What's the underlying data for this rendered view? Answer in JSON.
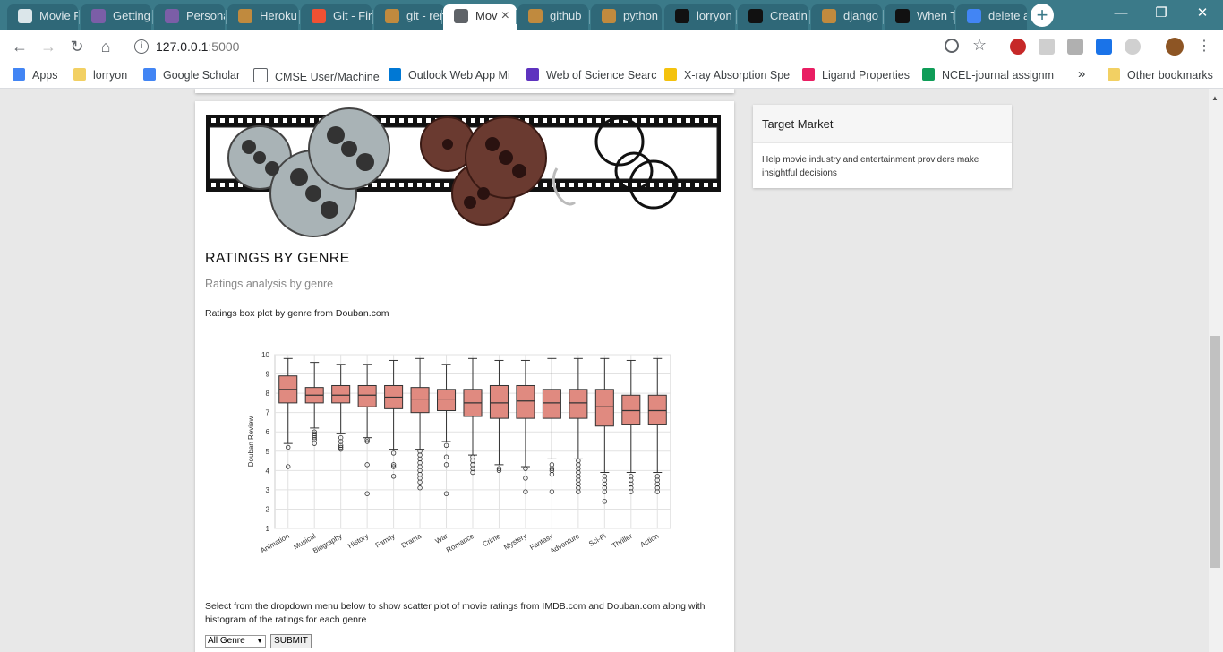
{
  "browser": {
    "tabs": [
      {
        "label": "Movie F",
        "icon_color": "#dbe6ea"
      },
      {
        "label": "Getting",
        "icon_color": "#7b5ea7"
      },
      {
        "label": "Persona",
        "icon_color": "#7b5ea7"
      },
      {
        "label": "Heroku",
        "icon_color": "#c08a3e"
      },
      {
        "label": "Git - Fir",
        "icon_color": "#f05133"
      },
      {
        "label": "git - rer",
        "icon_color": "#c08a3e"
      },
      {
        "label": "Mov",
        "icon_color": "#5f6368",
        "active": true
      },
      {
        "label": "github",
        "icon_color": "#c08a3e"
      },
      {
        "label": "python",
        "icon_color": "#c08a3e"
      },
      {
        "label": "lorryon",
        "icon_color": "#111111"
      },
      {
        "label": "Creatin",
        "icon_color": "#111111"
      },
      {
        "label": "django",
        "icon_color": "#c08a3e"
      },
      {
        "label": "When T",
        "icon_color": "#111111"
      },
      {
        "label": "delete a",
        "icon_color": "#4285f4"
      }
    ],
    "new_tab_symbol": "+",
    "window_controls": {
      "minimize": "—",
      "restore": "❐",
      "close": "✕"
    },
    "url_host": "127.0.0.1",
    "url_port": ":5000",
    "bookmarks": [
      {
        "label": "Apps",
        "icon": "apps-grid-icon",
        "color": "#4285f4"
      },
      {
        "label": "lorryon",
        "icon": "folder-icon",
        "color": "#f2d063"
      },
      {
        "label": "Google Scholar",
        "icon": "scholar-icon",
        "color": "#4285f4"
      },
      {
        "label": "CMSE User/Machine",
        "icon": "page-icon",
        "color": "#ffffff"
      },
      {
        "label": "Outlook Web App Mi",
        "icon": "outlook-icon",
        "color": "#0078d4"
      },
      {
        "label": "Web of Science Searc",
        "icon": "wos-icon",
        "color": "#5e33bf"
      },
      {
        "label": "X-ray Absorption Spe",
        "icon": "xray-icon",
        "color": "#f4c20d"
      },
      {
        "label": "Ligand Properties",
        "icon": "ligand-icon",
        "color": "#e91e63"
      },
      {
        "label": "NCEL-journal assignm",
        "icon": "sheets-icon",
        "color": "#0f9d58"
      }
    ],
    "bookmarks_overflow": "»",
    "other_bookmarks": "Other bookmarks"
  },
  "main": {
    "title": "RATINGS BY GENRE",
    "subtitle": "Ratings analysis by genre",
    "description": "Ratings box plot by genre from Douban.com",
    "select_description": "Select from the dropdown menu below to show scatter plot of movie ratings from IMDB.com and Douban.com along with histogram of the ratings for each genre",
    "genre_select_value": "All Genre",
    "submit_label": "SUBMIT"
  },
  "side": {
    "title": "Target Market",
    "body": "Help movie industry and entertainment providers make insightful decisions"
  },
  "colors": {
    "tab_strip": "#3b7a89",
    "box_fill": "#e08a80",
    "box_stroke": "#333333"
  },
  "chart_data": {
    "type": "box",
    "title": "",
    "xlabel": "",
    "ylabel": "Douban Review",
    "ylim": [
      1,
      10
    ],
    "yticks": [
      1,
      2,
      3,
      4,
      5,
      6,
      7,
      8,
      9,
      10
    ],
    "grid": true,
    "categories": [
      "Animation",
      "Musical",
      "Biography",
      "History",
      "Family",
      "Drama",
      "War",
      "Romance",
      "Crime",
      "Mystery",
      "Fantasy",
      "Adventure",
      "Sci-Fi",
      "Thriller",
      "Action"
    ],
    "series": [
      {
        "category": "Animation",
        "whisker_low": 5.4,
        "q1": 7.5,
        "median": 8.2,
        "q3": 8.9,
        "whisker_high": 9.8,
        "outliers": [
          5.2,
          4.2
        ]
      },
      {
        "category": "Musical",
        "whisker_low": 6.2,
        "q1": 7.5,
        "median": 7.9,
        "q3": 8.3,
        "whisker_high": 9.6,
        "outliers": [
          6.0,
          5.9,
          5.8,
          5.7,
          5.6,
          5.4
        ]
      },
      {
        "category": "Biography",
        "whisker_low": 5.9,
        "q1": 7.5,
        "median": 7.9,
        "q3": 8.4,
        "whisker_high": 9.5,
        "outliers": [
          5.7,
          5.5,
          5.3,
          5.2,
          5.1
        ]
      },
      {
        "category": "History",
        "whisker_low": 5.7,
        "q1": 7.3,
        "median": 7.9,
        "q3": 8.4,
        "whisker_high": 9.5,
        "outliers": [
          5.6,
          5.5,
          4.3,
          2.8
        ]
      },
      {
        "category": "Family",
        "whisker_low": 5.1,
        "q1": 7.2,
        "median": 7.8,
        "q3": 8.4,
        "whisker_high": 9.7,
        "outliers": [
          4.9,
          4.3,
          4.2,
          3.7
        ]
      },
      {
        "category": "Drama",
        "whisker_low": 5.1,
        "q1": 7.0,
        "median": 7.7,
        "q3": 8.3,
        "whisker_high": 9.8,
        "outliers": [
          5.0,
          4.8,
          4.6,
          4.4,
          4.2,
          4.0,
          3.8,
          3.6,
          3.4,
          3.1
        ]
      },
      {
        "category": "War",
        "whisker_low": 5.5,
        "q1": 7.1,
        "median": 7.7,
        "q3": 8.2,
        "whisker_high": 9.5,
        "outliers": [
          5.3,
          4.7,
          4.3,
          2.8
        ]
      },
      {
        "category": "Romance",
        "whisker_low": 4.8,
        "q1": 6.8,
        "median": 7.5,
        "q3": 8.2,
        "whisker_high": 9.8,
        "outliers": [
          4.7,
          4.5,
          4.3,
          4.1,
          3.9
        ]
      },
      {
        "category": "Crime",
        "whisker_low": 4.3,
        "q1": 6.7,
        "median": 7.5,
        "q3": 8.4,
        "whisker_high": 9.7,
        "outliers": [
          4.1,
          4.0
        ]
      },
      {
        "category": "Mystery",
        "whisker_low": 4.2,
        "q1": 6.7,
        "median": 7.6,
        "q3": 8.4,
        "whisker_high": 9.7,
        "outliers": [
          4.1,
          3.6,
          2.9
        ]
      },
      {
        "category": "Fantasy",
        "whisker_low": 4.6,
        "q1": 6.7,
        "median": 7.5,
        "q3": 8.2,
        "whisker_high": 9.8,
        "outliers": [
          4.3,
          4.1,
          4.0,
          3.8,
          2.9
        ]
      },
      {
        "category": "Adventure",
        "whisker_low": 4.6,
        "q1": 6.7,
        "median": 7.5,
        "q3": 8.2,
        "whisker_high": 9.8,
        "outliers": [
          4.5,
          4.3,
          4.1,
          3.9,
          3.7,
          3.5,
          3.3,
          3.1,
          2.9
        ]
      },
      {
        "category": "Sci-Fi",
        "whisker_low": 3.9,
        "q1": 6.3,
        "median": 7.3,
        "q3": 8.2,
        "whisker_high": 9.8,
        "outliers": [
          3.7,
          3.5,
          3.3,
          3.1,
          2.9,
          2.4
        ]
      },
      {
        "category": "Thriller",
        "whisker_low": 3.9,
        "q1": 6.4,
        "median": 7.1,
        "q3": 7.9,
        "whisker_high": 9.7,
        "outliers": [
          3.7,
          3.5,
          3.3,
          3.1,
          2.9
        ]
      },
      {
        "category": "Action",
        "whisker_low": 3.9,
        "q1": 6.4,
        "median": 7.1,
        "q3": 7.9,
        "whisker_high": 9.8,
        "outliers": [
          3.7,
          3.5,
          3.3,
          3.1,
          2.9
        ]
      }
    ]
  }
}
